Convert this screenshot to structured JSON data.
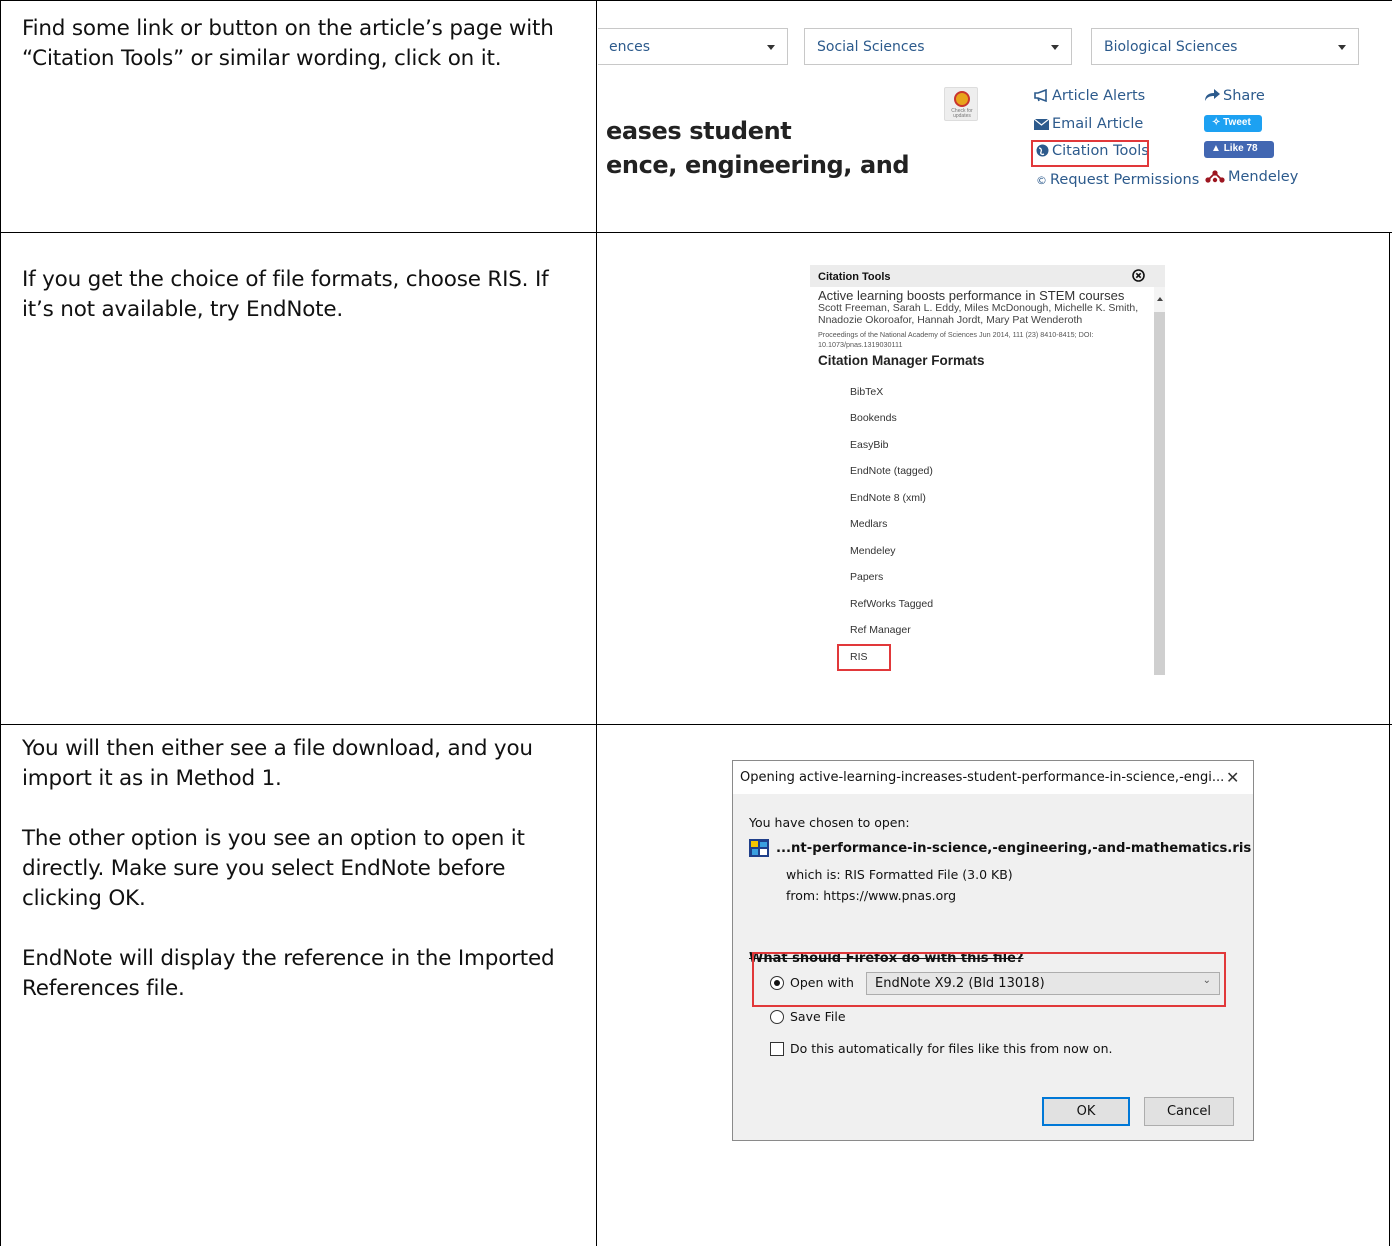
{
  "instructions": {
    "step1": "Find some link or button on the article’s page with “Citation Tools” or similar wording, click on it.",
    "step2": "If you get the choice of file formats, choose RIS. If it’s not available, try EndNote.",
    "step3": [
      "You will then either see a file download, and you import it as in Method 1.",
      "The other option is you see an option to open it directly. Make sure you select EndNote before clicking OK.",
      "EndNote will display the reference in the Imported References file."
    ]
  },
  "pnas_header": {
    "dropdowns": [
      "ences",
      "Social Sciences",
      "Biological Sciences"
    ],
    "title_lines": [
      "eases student",
      "ence, engineering, and"
    ],
    "check_updates": "Check for updates",
    "links": {
      "article_alerts": "Article Alerts",
      "email_article": "Email Article",
      "citation_tools": "Citation Tools",
      "request_permissions": "Request Permissions",
      "share": "Share",
      "tweet": "Tweet",
      "like": "Like 78",
      "mendeley": "Mendeley"
    },
    "colors": {
      "link": "#2c5a8c",
      "highlight": "#e1383a",
      "twitter": "#1da1f2",
      "facebook": "#4267b2",
      "mendeley": "#9d1620"
    }
  },
  "citation_tools": {
    "header": "Citation Tools",
    "article_title": "Active learning boosts performance in STEM courses",
    "authors": "Scott Freeman, Sarah L. Eddy, Miles McDonough, Michelle K. Smith, Nnadozie Okoroafor, Hannah Jordt, Mary Pat Wenderoth",
    "source": "Proceedings of the National Academy of Sciences Jun 2014, 111 (23) 8410-8415; DOI: 10.1073/pnas.1319030111",
    "formats_heading": "Citation Manager Formats",
    "formats": [
      "BibTeX",
      "Bookends",
      "EasyBib",
      "EndNote (tagged)",
      "EndNote 8 (xml)",
      "Medlars",
      "Mendeley",
      "Papers",
      "RefWorks Tagged",
      "Ref Manager",
      "RIS"
    ]
  },
  "firefox_dialog": {
    "title": "Opening active-learning-increases-student-performance-in-science,-engi...",
    "chosen_to_open": "You have chosen to open:",
    "filename": "...nt-performance-in-science,-engineering,-and-mathematics.ris",
    "which_is": "which is: RIS Formatted File (3.0 KB)",
    "from": "from: https://www.pnas.org",
    "question": "What should Firefox do with this file?",
    "open_with_label": "Open with",
    "open_with_value": "EndNote X9.2 (Bld 13018)",
    "save_file_label": "Save File",
    "auto_label": "Do this automatically for files like this from now on.",
    "ok": "OK",
    "cancel": "Cancel"
  }
}
